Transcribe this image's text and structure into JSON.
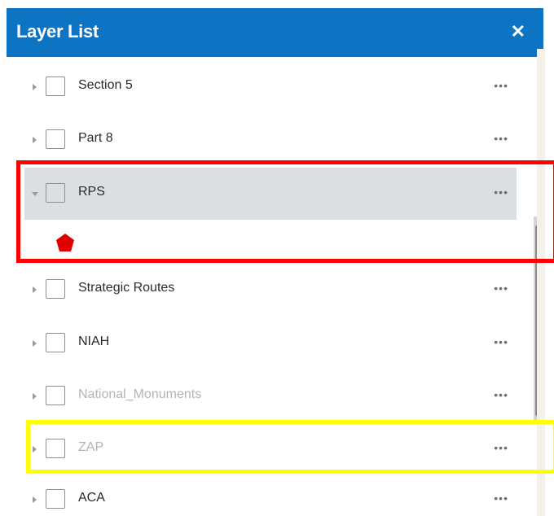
{
  "header": {
    "title": "Layer List",
    "close_icon": "close-icon"
  },
  "layers": [
    {
      "label": "Section 5",
      "expanded": false,
      "dim": false,
      "options": "•••"
    },
    {
      "label": "Part 8",
      "expanded": false,
      "dim": false,
      "options": "•••"
    },
    {
      "label": "RPS",
      "expanded": true,
      "dim": false,
      "selected": true,
      "options": "•••"
    },
    {
      "label": "Strategic Routes",
      "expanded": false,
      "dim": false,
      "options": "•••"
    },
    {
      "label": "NIAH",
      "expanded": false,
      "dim": false,
      "options": "•••"
    },
    {
      "label": "National_Monuments",
      "expanded": false,
      "dim": true,
      "options": "•••"
    },
    {
      "label": "ZAP",
      "expanded": false,
      "dim": true,
      "options": "•••"
    },
    {
      "label": "ACA",
      "expanded": false,
      "dim": false,
      "options": "•••"
    }
  ],
  "legend": {
    "symbol": "red-pentagon-icon",
    "color": "#e00000"
  },
  "colors": {
    "header": "#0d74c4",
    "selected_row": "#dcdfe1",
    "highlight_red": "#ff0000",
    "highlight_yellow": "#ffff00"
  }
}
